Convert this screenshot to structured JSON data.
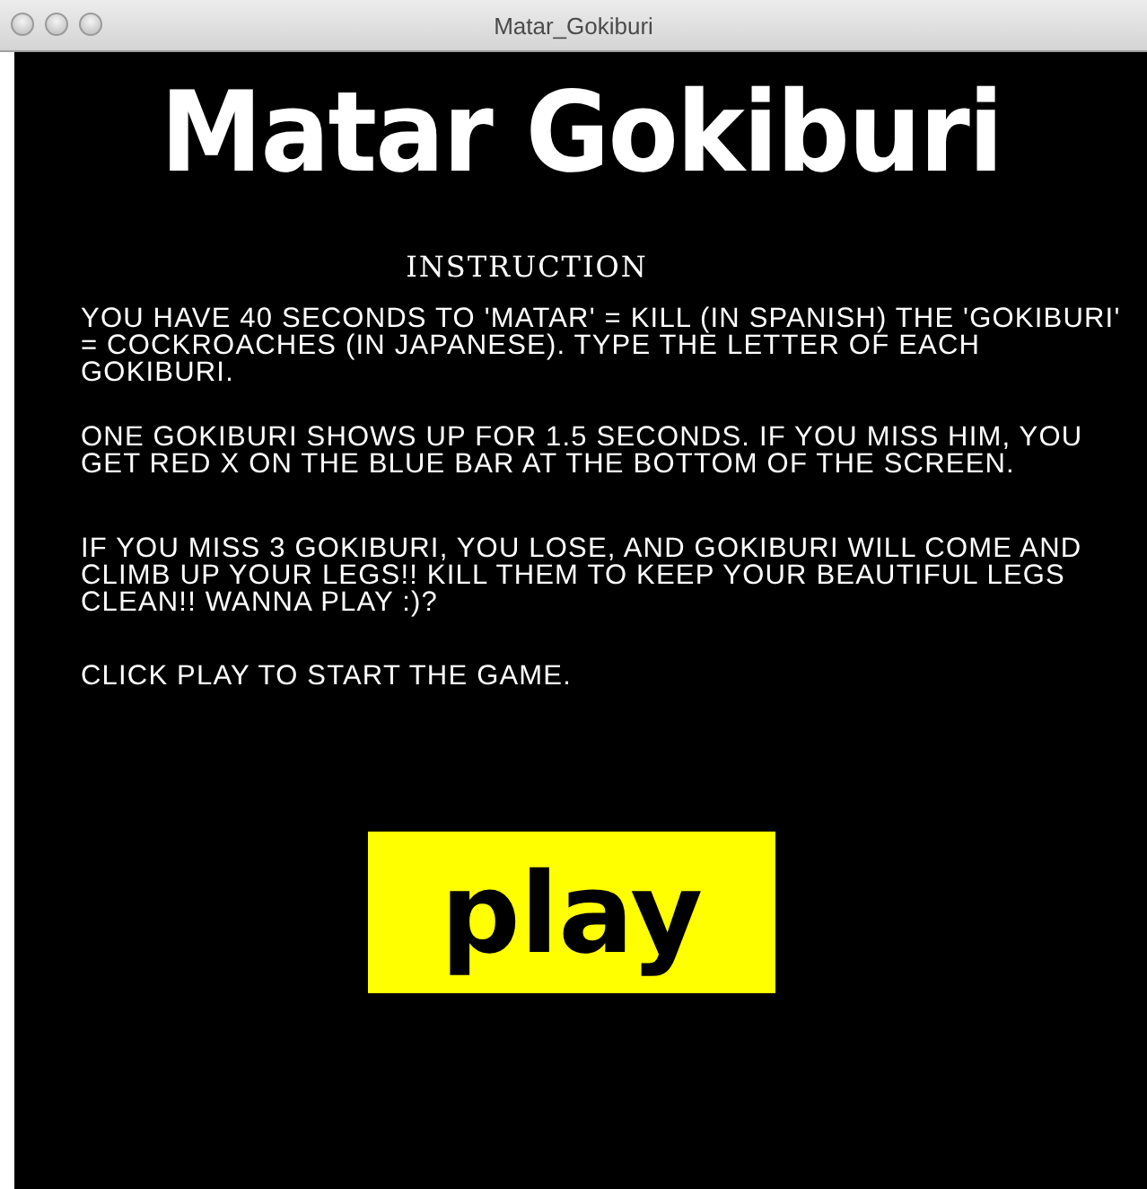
{
  "window": {
    "title": "Matar_Gokiburi"
  },
  "game_title": "Matar Gokiburi",
  "heading": "INSTRUCTION",
  "paragraphs": [
    "YOU HAVE 40 SECONDS TO 'MATAR' = KILL (IN SPANISH) THE 'GOKIBURI' = COCKROACHES (IN JAPANESE). TYPE THE LETTER OF EACH GOKIBURI.",
    "ONE GOKIBURI SHOWS UP FOR 1.5 SECONDS. IF YOU MISS HIM, YOU GET RED X ON THE BLUE BAR AT THE BOTTOM OF THE SCREEN.",
    "IF YOU MISS 3 GOKIBURI, YOU LOSE, AND GOKIBURI WILL COME AND CLIMB UP YOUR LEGS!! KILL THEM TO KEEP YOUR BEAUTIFUL LEGS CLEAN!! WANNA PLAY :)?",
    "CLICK PLAY TO START THE GAME."
  ],
  "play_button": "play"
}
